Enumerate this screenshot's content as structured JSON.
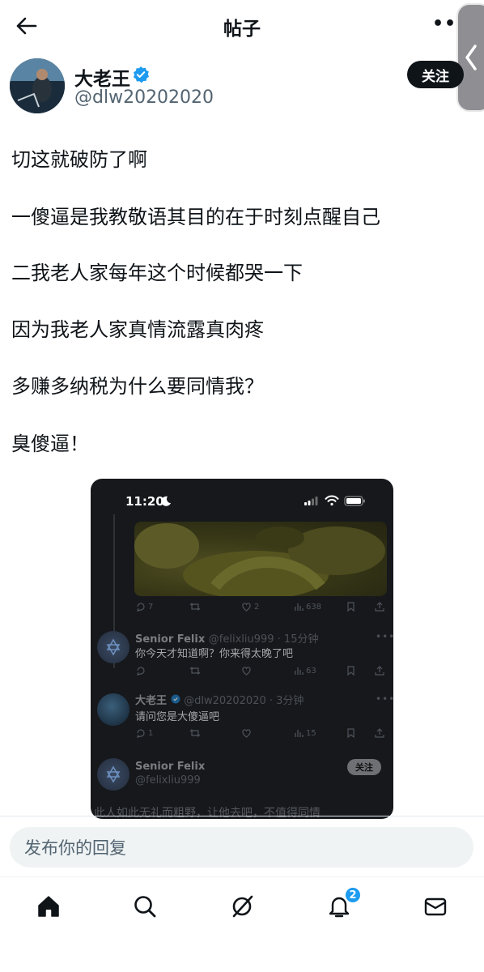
{
  "header": {
    "title": "帖子",
    "more": "•••"
  },
  "author": {
    "name": "大老王",
    "handle": "@dlw20202020",
    "follow_label": "关注",
    "verified": true
  },
  "post": {
    "lines": [
      "切这就破防了啊",
      "一傻逼是我教敬语其目的在于时刻点醒自己",
      "二我老人家每年这个时候都哭一下",
      "因为我老人家真情流露真肉疼",
      "多赚多纳税为什么要同情我？",
      "臭傻逼！"
    ]
  },
  "screenshot": {
    "time": "11:20",
    "media_actions": {
      "replies": "7",
      "likes": "2",
      "views": "638"
    },
    "comments": [
      {
        "name": "Senior Felix",
        "handle": "@felixliu999 · 15分钟",
        "text": "你今天才知道啊？你来得太晚了吧",
        "views": "63"
      },
      {
        "name": "大老王",
        "handle": "@dlw20202020 · 3分钟",
        "text": "请问您是大傻逼吧",
        "replies": "1",
        "views": "15"
      }
    ],
    "profile": {
      "name": "Senior Felix",
      "handle": "@felixliu999",
      "follow_label": "关注"
    },
    "footer_text": "此人如此无礼而粗野，让他去吧，不值得同情"
  },
  "reply": {
    "placeholder": "发布你的回复"
  },
  "tabbar": {
    "items": [
      "home-icon",
      "search-icon",
      "grok-icon",
      "notifications-icon",
      "messages-icon"
    ],
    "notification_count": "2"
  },
  "colors": {
    "accent": "#1d9bf0",
    "text": "#0f1419",
    "secondary": "#536471"
  }
}
